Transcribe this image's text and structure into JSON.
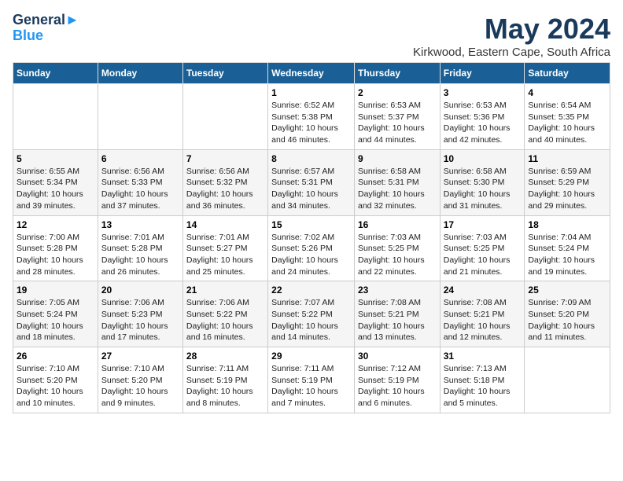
{
  "header": {
    "logo_line1": "General",
    "logo_line2": "Blue",
    "month_title": "May 2024",
    "location": "Kirkwood, Eastern Cape, South Africa"
  },
  "days_of_week": [
    "Sunday",
    "Monday",
    "Tuesday",
    "Wednesday",
    "Thursday",
    "Friday",
    "Saturday"
  ],
  "weeks": [
    [
      {
        "day": "",
        "info": ""
      },
      {
        "day": "",
        "info": ""
      },
      {
        "day": "",
        "info": ""
      },
      {
        "day": "1",
        "info": "Sunrise: 6:52 AM\nSunset: 5:38 PM\nDaylight: 10 hours\nand 46 minutes."
      },
      {
        "day": "2",
        "info": "Sunrise: 6:53 AM\nSunset: 5:37 PM\nDaylight: 10 hours\nand 44 minutes."
      },
      {
        "day": "3",
        "info": "Sunrise: 6:53 AM\nSunset: 5:36 PM\nDaylight: 10 hours\nand 42 minutes."
      },
      {
        "day": "4",
        "info": "Sunrise: 6:54 AM\nSunset: 5:35 PM\nDaylight: 10 hours\nand 40 minutes."
      }
    ],
    [
      {
        "day": "5",
        "info": "Sunrise: 6:55 AM\nSunset: 5:34 PM\nDaylight: 10 hours\nand 39 minutes."
      },
      {
        "day": "6",
        "info": "Sunrise: 6:56 AM\nSunset: 5:33 PM\nDaylight: 10 hours\nand 37 minutes."
      },
      {
        "day": "7",
        "info": "Sunrise: 6:56 AM\nSunset: 5:32 PM\nDaylight: 10 hours\nand 36 minutes."
      },
      {
        "day": "8",
        "info": "Sunrise: 6:57 AM\nSunset: 5:31 PM\nDaylight: 10 hours\nand 34 minutes."
      },
      {
        "day": "9",
        "info": "Sunrise: 6:58 AM\nSunset: 5:31 PM\nDaylight: 10 hours\nand 32 minutes."
      },
      {
        "day": "10",
        "info": "Sunrise: 6:58 AM\nSunset: 5:30 PM\nDaylight: 10 hours\nand 31 minutes."
      },
      {
        "day": "11",
        "info": "Sunrise: 6:59 AM\nSunset: 5:29 PM\nDaylight: 10 hours\nand 29 minutes."
      }
    ],
    [
      {
        "day": "12",
        "info": "Sunrise: 7:00 AM\nSunset: 5:28 PM\nDaylight: 10 hours\nand 28 minutes."
      },
      {
        "day": "13",
        "info": "Sunrise: 7:01 AM\nSunset: 5:28 PM\nDaylight: 10 hours\nand 26 minutes."
      },
      {
        "day": "14",
        "info": "Sunrise: 7:01 AM\nSunset: 5:27 PM\nDaylight: 10 hours\nand 25 minutes."
      },
      {
        "day": "15",
        "info": "Sunrise: 7:02 AM\nSunset: 5:26 PM\nDaylight: 10 hours\nand 24 minutes."
      },
      {
        "day": "16",
        "info": "Sunrise: 7:03 AM\nSunset: 5:25 PM\nDaylight: 10 hours\nand 22 minutes."
      },
      {
        "day": "17",
        "info": "Sunrise: 7:03 AM\nSunset: 5:25 PM\nDaylight: 10 hours\nand 21 minutes."
      },
      {
        "day": "18",
        "info": "Sunrise: 7:04 AM\nSunset: 5:24 PM\nDaylight: 10 hours\nand 19 minutes."
      }
    ],
    [
      {
        "day": "19",
        "info": "Sunrise: 7:05 AM\nSunset: 5:24 PM\nDaylight: 10 hours\nand 18 minutes."
      },
      {
        "day": "20",
        "info": "Sunrise: 7:06 AM\nSunset: 5:23 PM\nDaylight: 10 hours\nand 17 minutes."
      },
      {
        "day": "21",
        "info": "Sunrise: 7:06 AM\nSunset: 5:22 PM\nDaylight: 10 hours\nand 16 minutes."
      },
      {
        "day": "22",
        "info": "Sunrise: 7:07 AM\nSunset: 5:22 PM\nDaylight: 10 hours\nand 14 minutes."
      },
      {
        "day": "23",
        "info": "Sunrise: 7:08 AM\nSunset: 5:21 PM\nDaylight: 10 hours\nand 13 minutes."
      },
      {
        "day": "24",
        "info": "Sunrise: 7:08 AM\nSunset: 5:21 PM\nDaylight: 10 hours\nand 12 minutes."
      },
      {
        "day": "25",
        "info": "Sunrise: 7:09 AM\nSunset: 5:20 PM\nDaylight: 10 hours\nand 11 minutes."
      }
    ],
    [
      {
        "day": "26",
        "info": "Sunrise: 7:10 AM\nSunset: 5:20 PM\nDaylight: 10 hours\nand 10 minutes."
      },
      {
        "day": "27",
        "info": "Sunrise: 7:10 AM\nSunset: 5:20 PM\nDaylight: 10 hours\nand 9 minutes."
      },
      {
        "day": "28",
        "info": "Sunrise: 7:11 AM\nSunset: 5:19 PM\nDaylight: 10 hours\nand 8 minutes."
      },
      {
        "day": "29",
        "info": "Sunrise: 7:11 AM\nSunset: 5:19 PM\nDaylight: 10 hours\nand 7 minutes."
      },
      {
        "day": "30",
        "info": "Sunrise: 7:12 AM\nSunset: 5:19 PM\nDaylight: 10 hours\nand 6 minutes."
      },
      {
        "day": "31",
        "info": "Sunrise: 7:13 AM\nSunset: 5:18 PM\nDaylight: 10 hours\nand 5 minutes."
      },
      {
        "day": "",
        "info": ""
      }
    ]
  ]
}
